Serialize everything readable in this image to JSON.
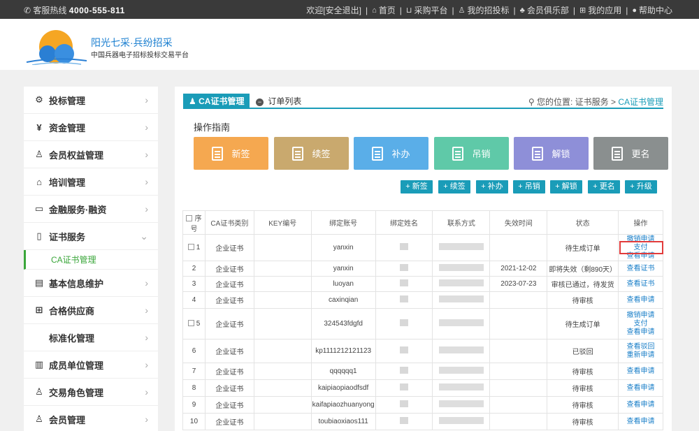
{
  "topbar": {
    "hotline_label": "客服热线",
    "hotline_number": "4000-555-811",
    "welcome": "欢迎",
    "logout": "[安全退出]",
    "links": [
      "首页",
      "采购平台",
      "我的招投标",
      "会员俱乐部",
      "我的应用",
      "帮助中心"
    ]
  },
  "header": {
    "brand_title": "阳光七采·兵纷招采",
    "brand_sub": "中国兵器电子招标投标交易平台"
  },
  "sidebar": {
    "items": [
      {
        "label": "投标管理",
        "icon": "gear-icon"
      },
      {
        "label": "资金管理",
        "icon": "yen-icon"
      },
      {
        "label": "会员权益管理",
        "icon": "users-icon"
      },
      {
        "label": "培训管理",
        "icon": "graduation-icon"
      },
      {
        "label": "金融服务·融资",
        "icon": "card-icon"
      },
      {
        "label": "证书服务",
        "icon": "phone-icon"
      }
    ],
    "sub_item": "CA证书管理",
    "items_after": [
      {
        "label": "基本信息维护",
        "icon": "form-icon"
      },
      {
        "label": "合格供应商",
        "icon": "plus-box-icon"
      },
      {
        "label": "标准化管理",
        "icon": ""
      },
      {
        "label": "成员单位管理",
        "icon": "building-icon"
      },
      {
        "label": "交易角色管理",
        "icon": "user-gear-icon"
      },
      {
        "label": "会员管理",
        "icon": "users-icon"
      }
    ]
  },
  "main": {
    "tab_active": "CA证书管理",
    "tab_second": "订单列表",
    "location_label": "您的位置:",
    "location_path": "证书服务 > ",
    "location_current": "CA证书管理",
    "guide_title": "操作指南",
    "big_buttons": [
      {
        "label": "新签",
        "color": "#f5a850"
      },
      {
        "label": "续签",
        "color": "#c9a96e"
      },
      {
        "label": "补办",
        "color": "#5aaee8"
      },
      {
        "label": "吊销",
        "color": "#5fc9a8"
      },
      {
        "label": "解锁",
        "color": "#8e8fd8"
      },
      {
        "label": "更名",
        "color": "#8a8f8f"
      }
    ],
    "small_buttons": [
      "+ 新签",
      "+ 续签",
      "+ 补办",
      "+ 吊销",
      "+ 解锁",
      "+ 更名",
      "+ 升级"
    ],
    "table": {
      "headers": [
        "序号",
        "CA证书类别",
        "KEY编号",
        "绑定账号",
        "绑定姓名",
        "联系方式",
        "失效时间",
        "状态",
        "操作"
      ],
      "rows": [
        {
          "no": "1",
          "check": true,
          "type": "企业证书",
          "account": "yanxin",
          "expire": "",
          "status": "待生成订单",
          "ops": [
            "撤销申请",
            "支付",
            "查看申请"
          ]
        },
        {
          "no": "2",
          "check": false,
          "type": "企业证书",
          "account": "yanxin",
          "expire": "2021-12-02",
          "status": "即将失效（剩890天）",
          "ops": [
            "查看证书"
          ]
        },
        {
          "no": "3",
          "check": false,
          "type": "企业证书",
          "account": "luoyan",
          "expire": "2023-07-23",
          "status": "审核已通过，待发货",
          "ops": [
            "查看证书"
          ]
        },
        {
          "no": "4",
          "check": false,
          "type": "企业证书",
          "account": "caxinqian",
          "expire": "",
          "status": "待审核",
          "ops": [
            "查看申请"
          ]
        },
        {
          "no": "5",
          "check": true,
          "type": "企业证书",
          "account": "324543fdgfd",
          "expire": "",
          "status": "待生成订单",
          "ops": [
            "撤销申请",
            "支付",
            "查看申请"
          ]
        },
        {
          "no": "6",
          "check": false,
          "type": "企业证书",
          "account": "kp1111212121123",
          "expire": "",
          "status": "已驳回",
          "ops": [
            "查看驳回",
            "重新申请"
          ]
        },
        {
          "no": "7",
          "check": false,
          "type": "企业证书",
          "account": "qqqqqq1",
          "expire": "",
          "status": "待审核",
          "ops": [
            "查看申请"
          ]
        },
        {
          "no": "8",
          "check": false,
          "type": "企业证书",
          "account": "kaipiaopiaodfsdf",
          "expire": "",
          "status": "待审核",
          "ops": [
            "查看申请"
          ]
        },
        {
          "no": "9",
          "check": false,
          "type": "企业证书",
          "account": "kaifapiaozhuanyong",
          "expire": "",
          "status": "待审核",
          "ops": [
            "查看申请"
          ]
        },
        {
          "no": "10",
          "check": false,
          "type": "企业证书",
          "account": "toubiaoxiaos111",
          "expire": "",
          "status": "待审核",
          "ops": [
            "查看申请"
          ]
        }
      ]
    }
  },
  "colors": {
    "accent": "#1a9cb8",
    "link": "#1a7fc8",
    "sidebar_active": "#3aa63a",
    "highlight": "#e23b3b"
  }
}
